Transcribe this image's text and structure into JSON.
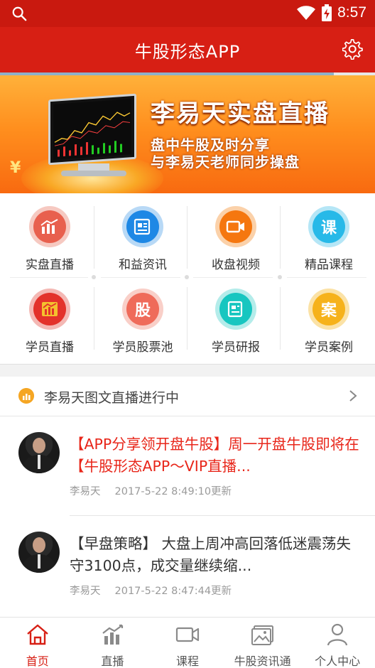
{
  "status_bar": {
    "time": "8:57"
  },
  "app": {
    "title": "牛股形态APP"
  },
  "banner": {
    "headline": "李易天实盘直播",
    "line1": "盘中牛股及时分享",
    "line2": "与李易天老师同步操盘",
    "symbol": "¥"
  },
  "menu": {
    "items": [
      {
        "label": "实盘直播",
        "icon": "chart-bars-icon",
        "color": "#e8604e",
        "ring": "#f6c9c1",
        "glyph": ""
      },
      {
        "label": "和益资讯",
        "icon": "news-icon",
        "color": "#1e88e5",
        "ring": "#b8d9f6",
        "glyph": ""
      },
      {
        "label": "收盘视频",
        "icon": "video-camera-icon",
        "color": "#f5770f",
        "ring": "#fbd1a9",
        "glyph": ""
      },
      {
        "label": "精品课程",
        "icon": "course-icon",
        "color": "#27b9e8",
        "ring": "#b5e6f6",
        "glyph": "课"
      },
      {
        "label": "学员直播",
        "icon": "student-live-icon",
        "color": "#e3322b",
        "ring": "#f4b8b4",
        "glyph": ""
      },
      {
        "label": "学员股票池",
        "icon": "stock-pool-icon",
        "color": "#ef6b5a",
        "ring": "#f9cfc8",
        "glyph": "股"
      },
      {
        "label": "学员研报",
        "icon": "research-report-icon",
        "color": "#17c6c0",
        "ring": "#b4ecea",
        "glyph": ""
      },
      {
        "label": "学员案例",
        "icon": "case-icon",
        "color": "#f6b21b",
        "ring": "#fbe2a6",
        "glyph": "案"
      }
    ]
  },
  "live": {
    "header": "李易天图文直播进行中"
  },
  "feed": [
    {
      "text": "【APP分享领开盘牛股】周一开盘牛股即将在【牛股形态APP～VIP直播...",
      "author": "李易天",
      "updated": "2017-5-22 8:49:10更新",
      "highlight": true
    },
    {
      "text": "【早盘策略】 大盘上周冲高回落低迷震荡失守3100点，成交量继续缩...",
      "author": "李易天",
      "updated": "2017-5-22 8:47:44更新",
      "highlight": false
    }
  ],
  "bottom_nav": {
    "tabs": [
      {
        "label": "首页",
        "icon": "home-icon",
        "active": true
      },
      {
        "label": "直播",
        "icon": "live-chart-icon",
        "active": false
      },
      {
        "label": "课程",
        "icon": "video-icon",
        "active": false
      },
      {
        "label": "牛股资讯通",
        "icon": "picture-news-icon",
        "active": false
      },
      {
        "label": "个人中心",
        "icon": "person-icon",
        "active": false
      }
    ]
  },
  "colors": {
    "primary": "#d71f14",
    "highlight_text": "#e8261a"
  }
}
